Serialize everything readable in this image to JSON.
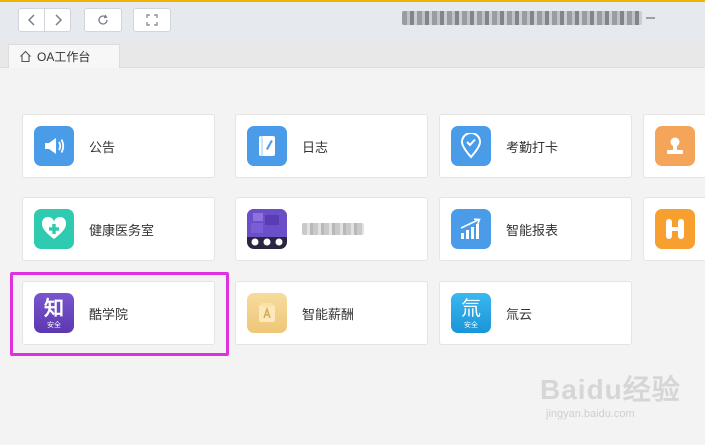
{
  "toolbar": {
    "back_icon": "chevron-left",
    "forward_icon": "chevron-right",
    "reload_icon": "reload",
    "fullscreen_icon": "fullscreen"
  },
  "tab": {
    "label": "OA工作台",
    "icon": "home-icon"
  },
  "apps": [
    {
      "label": "公告",
      "icon": "megaphone-icon",
      "color": "#4a9be8"
    },
    {
      "label": "日志",
      "icon": "notebook-icon",
      "color": "#4a9be8"
    },
    {
      "label": "考勤打卡",
      "icon": "location-check-icon",
      "color": "#4a9be8"
    },
    {
      "label": "",
      "icon": "stamp-icon",
      "color": "#f5a55a"
    },
    {
      "label": "健康医务室",
      "icon": "heart-plus-icon",
      "color": "#2ecbb0"
    },
    {
      "label": "",
      "icon": "blurred-app-icon",
      "color": "#6b4fc8"
    },
    {
      "label": "智能报表",
      "icon": "chart-up-icon",
      "color": "#4a9be8"
    },
    {
      "label": "",
      "icon": "h-app-icon",
      "color": "#f7a030"
    },
    {
      "label": "酷学院",
      "icon": "zhi-icon",
      "icon_text": "知",
      "badge": "安全",
      "color": "#6a47c2"
    },
    {
      "label": "智能薪酬",
      "icon": "salary-icon",
      "color": "#f2cf86"
    },
    {
      "label": "氚云",
      "icon": "chuan-cloud-icon",
      "icon_text": "氚",
      "badge": "安全",
      "color": "#27a9e6"
    }
  ],
  "watermark": {
    "text": "Baidu经验",
    "sub": "jingyan.baidu.com"
  },
  "colors": {
    "highlight": "#e031e0",
    "accent": "#4a9be8"
  }
}
